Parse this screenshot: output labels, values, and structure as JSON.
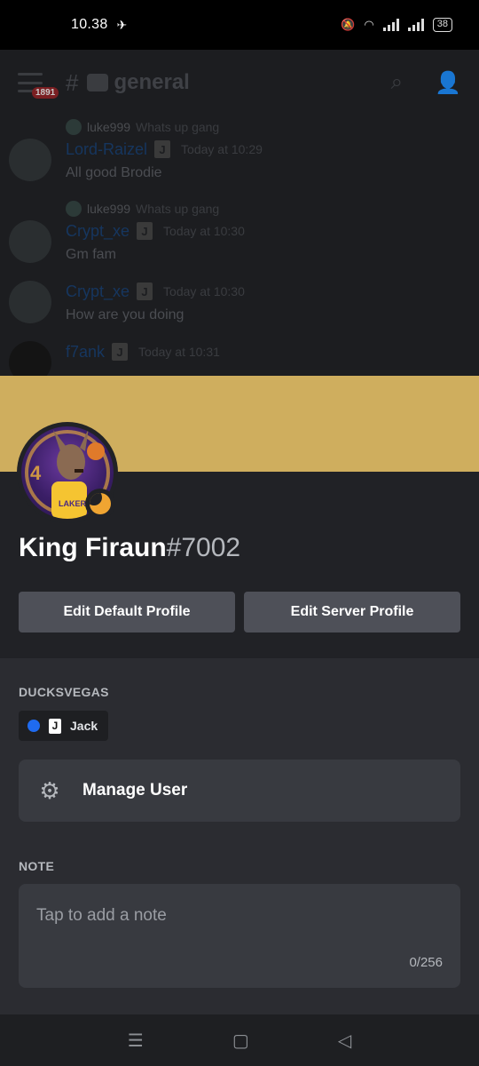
{
  "status_bar": {
    "time": "10.38",
    "battery": "38"
  },
  "chat": {
    "channel_name": "general",
    "mention_badge": "1891",
    "messages": [
      {
        "reply_user": "luke999",
        "reply_text": "Whats up gang",
        "author": "Lord-Raizel",
        "role_icon": "J",
        "timestamp": "Today at 10:29",
        "text": "All good Brodie"
      },
      {
        "reply_user": "luke999",
        "reply_text": "Whats up gang",
        "author": "Crypt_xe",
        "role_icon": "J",
        "timestamp": "Today at 10:30",
        "text": "Gm fam"
      },
      {
        "author": "Crypt_xe",
        "role_icon": "J",
        "timestamp": "Today at 10:30",
        "text": "How are you doing"
      },
      {
        "author": "f7ank",
        "role_icon": "J",
        "timestamp": "Today at 10:31",
        "text": ""
      }
    ]
  },
  "profile": {
    "banner_color": "#cfae5e",
    "username": "King Firaun",
    "discriminator": "#7002",
    "status": "idle",
    "buttons": {
      "edit_default": "Edit Default Profile",
      "edit_server": "Edit Server Profile"
    },
    "server_section_label": "DUCKSVEGAS",
    "role": {
      "icon": "J",
      "name": "Jack",
      "color": "#1f6bf0"
    },
    "manage_user_label": "Manage User",
    "note_label": "NOTE",
    "note_placeholder": "Tap to add a note",
    "note_count": "0/256"
  }
}
